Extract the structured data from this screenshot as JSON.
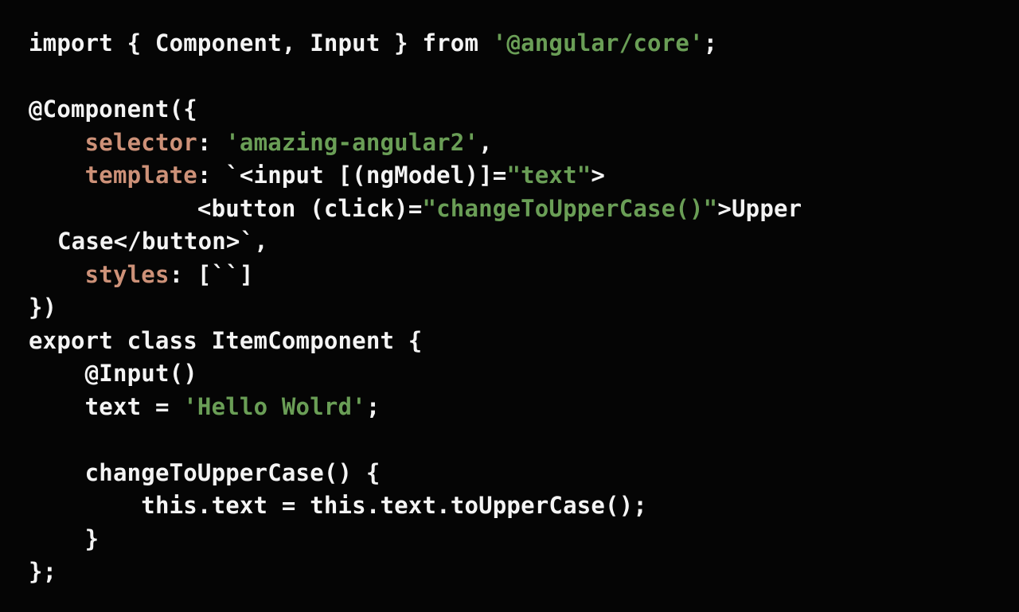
{
  "editor": {
    "language": "typescript",
    "background_color": "#050505",
    "default_text_color": "#f4f4f4",
    "font_size_px": 29,
    "line_height_px": 41.5,
    "colors": {
      "plain": "#f4f4f4",
      "string": "#6a9e56",
      "property": "#cd9178"
    }
  },
  "code": {
    "lines": [
      {
        "id": 1,
        "text": "import { Component, Input } from '@angular/core';",
        "tokens": [
          {
            "t": "import { Component, Input } from ",
            "c": "plain"
          },
          {
            "t": "'@angular/core'",
            "c": "string"
          },
          {
            "t": ";",
            "c": "plain"
          }
        ]
      },
      {
        "id": 2,
        "text": "",
        "tokens": []
      },
      {
        "id": 3,
        "text": "@Component({",
        "tokens": [
          {
            "t": "@Component({",
            "c": "plain"
          }
        ]
      },
      {
        "id": 4,
        "text": "    selector: 'amazing-angular2',",
        "tokens": [
          {
            "t": "    ",
            "c": "plain"
          },
          {
            "t": "selector",
            "c": "property"
          },
          {
            "t": ": ",
            "c": "plain"
          },
          {
            "t": "'amazing-angular2'",
            "c": "string"
          },
          {
            "t": ",",
            "c": "plain"
          }
        ]
      },
      {
        "id": 5,
        "text": "    template: `<input [(ngModel)]=\"text\">",
        "tokens": [
          {
            "t": "    ",
            "c": "plain"
          },
          {
            "t": "template",
            "c": "property"
          },
          {
            "t": ": `<input [(ngModel)]=",
            "c": "plain"
          },
          {
            "t": "\"text\"",
            "c": "string"
          },
          {
            "t": ">",
            "c": "plain"
          }
        ]
      },
      {
        "id": 6,
        "text": "            <button (click)=\"changeToUpperCase()\">Upper Case</button>`,",
        "tokens": [
          {
            "t": "            <button (click)=",
            "c": "plain"
          },
          {
            "t": "\"changeToUpperCase()\"",
            "c": "string"
          },
          {
            "t": ">Upper Case</button>`,",
            "c": "plain"
          }
        ]
      },
      {
        "id": 7,
        "text": "    styles: [``]",
        "tokens": [
          {
            "t": "    ",
            "c": "plain"
          },
          {
            "t": "styles",
            "c": "property"
          },
          {
            "t": ": [``]",
            "c": "plain"
          }
        ]
      },
      {
        "id": 8,
        "text": "})",
        "tokens": [
          {
            "t": "})",
            "c": "plain"
          }
        ]
      },
      {
        "id": 9,
        "text": "export class ItemComponent {",
        "tokens": [
          {
            "t": "export class ItemComponent {",
            "c": "plain"
          }
        ]
      },
      {
        "id": 10,
        "text": "    @Input()",
        "tokens": [
          {
            "t": "    @Input()",
            "c": "plain"
          }
        ]
      },
      {
        "id": 11,
        "text": "    text = 'Hello Wolrd';",
        "tokens": [
          {
            "t": "    text = ",
            "c": "plain"
          },
          {
            "t": "'Hello Wolrd'",
            "c": "string"
          },
          {
            "t": ";",
            "c": "plain"
          }
        ]
      },
      {
        "id": 12,
        "text": "",
        "tokens": []
      },
      {
        "id": 13,
        "text": "    changeToUpperCase() {",
        "tokens": [
          {
            "t": "    changeToUpperCase() {",
            "c": "plain"
          }
        ]
      },
      {
        "id": 14,
        "text": "        this.text = this.text.toUpperCase();",
        "tokens": [
          {
            "t": "        this.text = this.text.toUpperCase();",
            "c": "plain"
          }
        ]
      },
      {
        "id": 15,
        "text": "    }",
        "tokens": [
          {
            "t": "    }",
            "c": "plain"
          }
        ]
      },
      {
        "id": 16,
        "text": "};",
        "tokens": [
          {
            "t": "};",
            "c": "plain"
          }
        ]
      }
    ]
  }
}
